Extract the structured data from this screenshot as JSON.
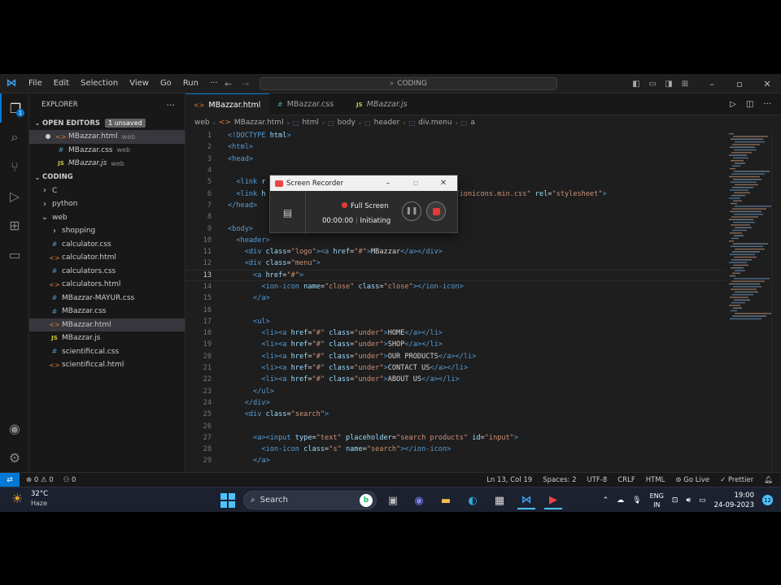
{
  "menu": [
    "File",
    "Edit",
    "Selection",
    "View",
    "Go",
    "Run",
    "···"
  ],
  "command_center": "CODING",
  "explorer": {
    "title": "EXPLORER",
    "open_editors_label": "OPEN EDITORS",
    "unsaved_badge": "1 unsaved",
    "open_editors": [
      {
        "name": "MBazzar.html",
        "desc": "web",
        "type": "html",
        "dirty": true,
        "italic": false
      },
      {
        "name": "MBazzar.css",
        "desc": "web",
        "type": "css",
        "dirty": false,
        "italic": false
      },
      {
        "name": "MBazzar.js",
        "desc": "web",
        "type": "js",
        "dirty": false,
        "italic": true
      }
    ],
    "workspace_label": "CODING",
    "tree": [
      {
        "name": "C",
        "kind": "folder",
        "open": false,
        "depth": 1
      },
      {
        "name": "python",
        "kind": "folder",
        "open": false,
        "depth": 1
      },
      {
        "name": "web",
        "kind": "folder",
        "open": true,
        "depth": 1
      },
      {
        "name": "shopping",
        "kind": "folder",
        "open": false,
        "depth": 2
      },
      {
        "name": "calculator.css",
        "kind": "css",
        "depth": 2
      },
      {
        "name": "calculator.html",
        "kind": "html",
        "depth": 2
      },
      {
        "name": "calculators.css",
        "kind": "css",
        "depth": 2
      },
      {
        "name": "calculators.html",
        "kind": "html",
        "depth": 2
      },
      {
        "name": "MBazzar-MAYUR.css",
        "kind": "css",
        "depth": 2
      },
      {
        "name": "MBazzar.css",
        "kind": "css",
        "depth": 2
      },
      {
        "name": "MBazzar.html",
        "kind": "html",
        "depth": 2,
        "selected": true
      },
      {
        "name": "MBazzar.js",
        "kind": "js",
        "depth": 2
      },
      {
        "name": "scientificcal.css",
        "kind": "css",
        "depth": 2
      },
      {
        "name": "scientificcal.html",
        "kind": "html",
        "depth": 2
      }
    ]
  },
  "tabs": [
    {
      "name": "MBazzar.html",
      "type": "html",
      "active": true,
      "dirty": true,
      "italic": false
    },
    {
      "name": "MBazzar.css",
      "type": "css",
      "active": false,
      "dirty": false,
      "italic": false
    },
    {
      "name": "MBazzar.js",
      "type": "js",
      "active": false,
      "dirty": false,
      "italic": true
    }
  ],
  "breadcrumb": [
    "web",
    "MBazzar.html",
    "html",
    "body",
    "header",
    "div.menu",
    "a"
  ],
  "current_line": 13,
  "code": [
    [
      [
        "t",
        "<!DOCTYPE "
      ],
      [
        "a",
        "html"
      ],
      [
        "t",
        ">"
      ]
    ],
    [
      [
        "t",
        "<html>"
      ]
    ],
    [
      [
        "t",
        "<head>"
      ]
    ],
    [],
    [
      [
        "w",
        "  "
      ],
      [
        "t",
        "<link "
      ],
      [
        "a",
        "r"
      ]
    ],
    [
      [
        "w",
        "  "
      ],
      [
        "t",
        "<link "
      ],
      [
        "a",
        "h"
      ],
      [
        "w",
        "                                    "
      ],
      [
        "s",
        "/dist/css/ionicons.min.css\""
      ],
      [
        "w",
        " "
      ],
      [
        "a",
        "rel"
      ],
      [
        "w",
        "="
      ],
      [
        "s",
        "\"stylesheet\""
      ],
      [
        "t",
        ">"
      ]
    ],
    [
      [
        "t",
        "</head>"
      ]
    ],
    [],
    [
      [
        "t",
        "<body>"
      ]
    ],
    [
      [
        "w",
        "  "
      ],
      [
        "t",
        "<header>"
      ]
    ],
    [
      [
        "w",
        "    "
      ],
      [
        "t",
        "<div "
      ],
      [
        "a",
        "class"
      ],
      [
        "w",
        "="
      ],
      [
        "s",
        "\"logo\""
      ],
      [
        "t",
        "><a "
      ],
      [
        "a",
        "href"
      ],
      [
        "w",
        "="
      ],
      [
        "s",
        "\"#\""
      ],
      [
        "t",
        ">"
      ],
      [
        "w",
        "MBazzar"
      ],
      [
        "t",
        "</a></div>"
      ]
    ],
    [
      [
        "w",
        "    "
      ],
      [
        "t",
        "<div "
      ],
      [
        "a",
        "class"
      ],
      [
        "w",
        "="
      ],
      [
        "s",
        "\"menu\""
      ],
      [
        "t",
        ">"
      ]
    ],
    [
      [
        "w",
        "      "
      ],
      [
        "t",
        "<a "
      ],
      [
        "a",
        "href"
      ],
      [
        "w",
        "="
      ],
      [
        "s",
        "\"#\""
      ],
      [
        "t",
        ">"
      ]
    ],
    [
      [
        "w",
        "        "
      ],
      [
        "t",
        "<ion-icon "
      ],
      [
        "a",
        "name"
      ],
      [
        "w",
        "="
      ],
      [
        "s",
        "\"close\""
      ],
      [
        "w",
        " "
      ],
      [
        "a",
        "class"
      ],
      [
        "w",
        "="
      ],
      [
        "s",
        "\"close\""
      ],
      [
        "t",
        "></ion-icon>"
      ]
    ],
    [
      [
        "w",
        "      "
      ],
      [
        "t",
        "</a>"
      ]
    ],
    [],
    [
      [
        "w",
        "      "
      ],
      [
        "t",
        "<ul>"
      ]
    ],
    [
      [
        "w",
        "        "
      ],
      [
        "t",
        "<li><a "
      ],
      [
        "a",
        "href"
      ],
      [
        "w",
        "="
      ],
      [
        "s",
        "\"#\""
      ],
      [
        "w",
        " "
      ],
      [
        "a",
        "class"
      ],
      [
        "w",
        "="
      ],
      [
        "s",
        "\"under\""
      ],
      [
        "t",
        ">"
      ],
      [
        "w",
        "HOME"
      ],
      [
        "t",
        "</a></li>"
      ]
    ],
    [
      [
        "w",
        "        "
      ],
      [
        "t",
        "<li><a "
      ],
      [
        "a",
        "href"
      ],
      [
        "w",
        "="
      ],
      [
        "s",
        "\"#\""
      ],
      [
        "w",
        " "
      ],
      [
        "a",
        "class"
      ],
      [
        "w",
        "="
      ],
      [
        "s",
        "\"under\""
      ],
      [
        "t",
        ">"
      ],
      [
        "w",
        "SHOP"
      ],
      [
        "t",
        "</a></li>"
      ]
    ],
    [
      [
        "w",
        "        "
      ],
      [
        "t",
        "<li><a "
      ],
      [
        "a",
        "href"
      ],
      [
        "w",
        "="
      ],
      [
        "s",
        "\"#\""
      ],
      [
        "w",
        " "
      ],
      [
        "a",
        "class"
      ],
      [
        "w",
        "="
      ],
      [
        "s",
        "\"under\""
      ],
      [
        "t",
        ">"
      ],
      [
        "w",
        "OUR PRODUCTS"
      ],
      [
        "t",
        "</a></li>"
      ]
    ],
    [
      [
        "w",
        "        "
      ],
      [
        "t",
        "<li><a "
      ],
      [
        "a",
        "href"
      ],
      [
        "w",
        "="
      ],
      [
        "s",
        "\"#\""
      ],
      [
        "w",
        " "
      ],
      [
        "a",
        "class"
      ],
      [
        "w",
        "="
      ],
      [
        "s",
        "\"under\""
      ],
      [
        "t",
        ">"
      ],
      [
        "w",
        "CONTACT US"
      ],
      [
        "t",
        "</a></li>"
      ]
    ],
    [
      [
        "w",
        "        "
      ],
      [
        "t",
        "<li><a "
      ],
      [
        "a",
        "href"
      ],
      [
        "w",
        "="
      ],
      [
        "s",
        "\"#\""
      ],
      [
        "w",
        " "
      ],
      [
        "a",
        "class"
      ],
      [
        "w",
        "="
      ],
      [
        "s",
        "\"under\""
      ],
      [
        "t",
        ">"
      ],
      [
        "w",
        "ABOUT US"
      ],
      [
        "t",
        "</a></li>"
      ]
    ],
    [
      [
        "w",
        "      "
      ],
      [
        "t",
        "</ul>"
      ]
    ],
    [
      [
        "w",
        "    "
      ],
      [
        "t",
        "</div>"
      ]
    ],
    [
      [
        "w",
        "    "
      ],
      [
        "t",
        "<div "
      ],
      [
        "a",
        "class"
      ],
      [
        "w",
        "="
      ],
      [
        "s",
        "\"search\""
      ],
      [
        "t",
        ">"
      ]
    ],
    [],
    [
      [
        "w",
        "      "
      ],
      [
        "t",
        "<a><input "
      ],
      [
        "a",
        "type"
      ],
      [
        "w",
        "="
      ],
      [
        "s",
        "\"text\""
      ],
      [
        "w",
        " "
      ],
      [
        "a",
        "placeholder"
      ],
      [
        "w",
        "="
      ],
      [
        "s",
        "\"search products\""
      ],
      [
        "w",
        " "
      ],
      [
        "a",
        "id"
      ],
      [
        "w",
        "="
      ],
      [
        "s",
        "\"input\""
      ],
      [
        "t",
        ">"
      ]
    ],
    [
      [
        "w",
        "        "
      ],
      [
        "t",
        "<ion-icon "
      ],
      [
        "a",
        "class"
      ],
      [
        "w",
        "="
      ],
      [
        "s",
        "\"s\""
      ],
      [
        "w",
        " "
      ],
      [
        "a",
        "name"
      ],
      [
        "w",
        "="
      ],
      [
        "s",
        "\"search\""
      ],
      [
        "t",
        "></ion-icon>"
      ]
    ],
    [
      [
        "w",
        "      "
      ],
      [
        "t",
        "</a>"
      ]
    ]
  ],
  "status": {
    "errors": "0",
    "warnings": "0",
    "ports": "0",
    "position": "Ln 13, Col 19",
    "spaces": "Spaces: 2",
    "encoding": "UTF-8",
    "eol": "CRLF",
    "language": "HTML",
    "golive": "Go Live",
    "prettier": "Prettier"
  },
  "recorder": {
    "title": "Screen Recorder",
    "mode": "Full Screen",
    "time": "00:00:00",
    "state": "Initiating"
  },
  "taskbar": {
    "temp": "32°C",
    "weather": "Haze",
    "search": "Search",
    "lang1": "ENG",
    "lang2": "IN",
    "time": "19:00",
    "date": "24-09-2023",
    "notifications": "12"
  },
  "colors": {
    "accent": "#0078d4",
    "tag": "#569cd6",
    "attr": "#9cdcfe",
    "string": "#ce9178"
  }
}
